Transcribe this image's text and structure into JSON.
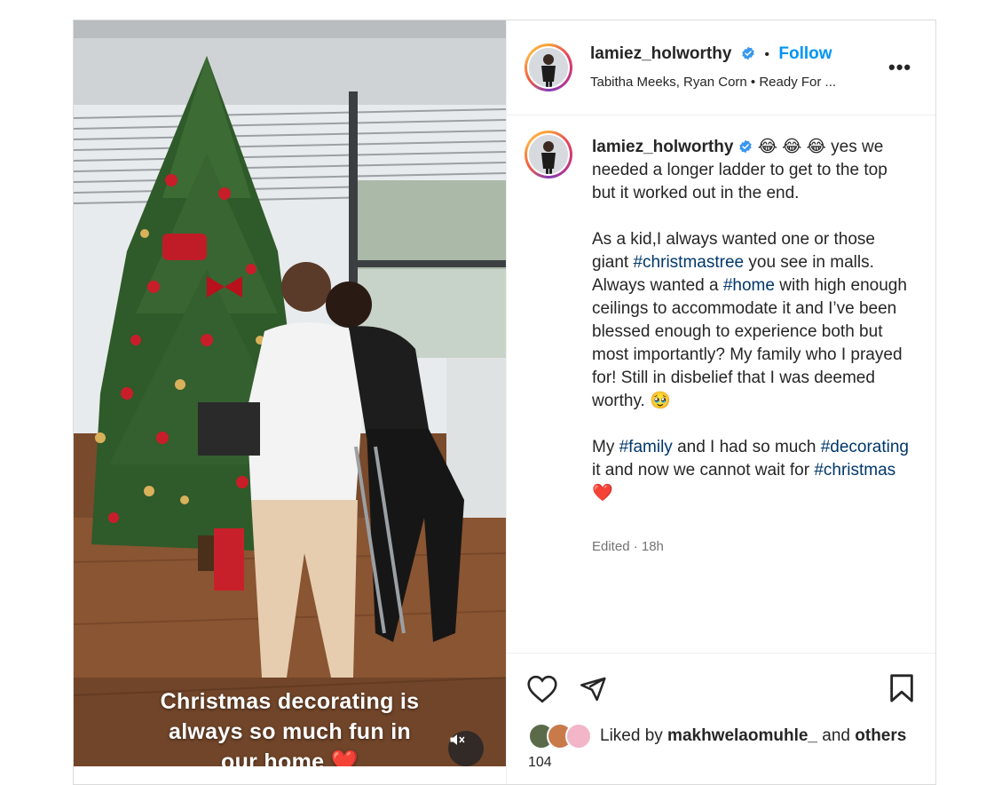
{
  "header": {
    "username": "lamiez_holworthy",
    "separator": "•",
    "follow_label": "Follow",
    "audio_line": "Tabitha Meeks, Ryan Corn • Ready For ...",
    "more_label": "•••"
  },
  "media": {
    "overlay_lines": [
      "Christmas decorating is",
      "always so much fun in",
      "our home ❤️"
    ]
  },
  "caption": {
    "username": "lamiez_holworthy",
    "emojis": "😂 😂 😂",
    "p1": "yes we needed a longer ladder to get to the top but it worked out in the end.",
    "p2_a": "As a kid,I always wanted one or those giant ",
    "p2_tag1": "#christmastree",
    "p2_b": " you see in malls. Always wanted a ",
    "p2_tag2": "#home",
    "p2_c": " with high enough ceilings to accommodate it and I’ve been blessed enough to experience both but most importantly? My family who I prayed for! Still in disbelief that I was deemed worthy. 🥹",
    "p3_a": "My ",
    "p3_tag1": "#family",
    "p3_b": " and I had so much ",
    "p3_tag2": "#decorating",
    "p3_c": " it and now we cannot wait for ",
    "p3_tag3": "#christmas",
    "p3_d": " ❤️",
    "edited": "Edited · 18h"
  },
  "likes": {
    "prefix": "Liked by ",
    "user": "makhwelaomuhle_",
    "middle": " and ",
    "suffix": "others",
    "count": "104"
  },
  "colors": {
    "accent": "#0095f6",
    "hashtag": "#00376b",
    "verified": "#3897f0",
    "heart": "#e0245e"
  }
}
